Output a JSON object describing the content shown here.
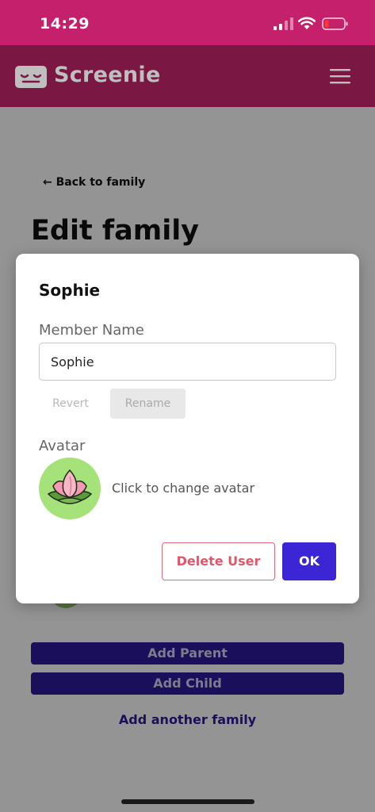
{
  "status_bar": {
    "time": "14:29"
  },
  "app_bar": {
    "title": "Screenie",
    "logo_icon": "sleepy-face-icon",
    "menu_icon": "hamburger-menu-icon"
  },
  "page": {
    "back_link": "← Back to family",
    "title": "Edit family",
    "add_parent_label": "Add Parent",
    "add_child_label": "Add Child",
    "add_family_label": "Add another family"
  },
  "modal": {
    "title": "Sophie",
    "name_label": "Member Name",
    "name_value": "Sophie",
    "revert_label": "Revert",
    "rename_label": "Rename",
    "avatar_label": "Avatar",
    "avatar_icon": "lotus-flower-icon",
    "avatar_hint": "Click to change avatar",
    "delete_label": "Delete User",
    "ok_label": "OK"
  },
  "colors": {
    "status_bar": "#c4206b",
    "app_bar": "#7a1743",
    "primary": "#2c1a9e",
    "ok_button": "#3b25d4",
    "danger": "#e0566a",
    "avatar_bg": "#a5e27a"
  }
}
